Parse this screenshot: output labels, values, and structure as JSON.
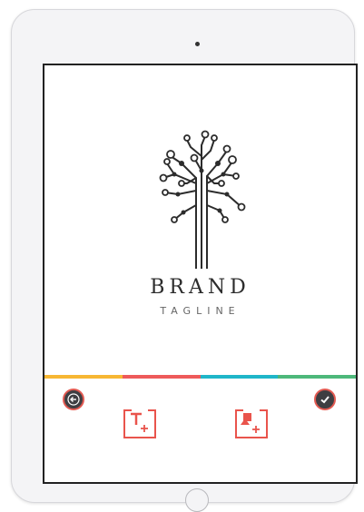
{
  "logo": {
    "brand": "BRAND",
    "tagline": "TAGLINE",
    "icon": "circuit-tree-icon"
  },
  "colors": {
    "accent": "#e9544c",
    "bar_segments": [
      "#f7b733",
      "#ee5a5a",
      "#1fb6c9",
      "#4db87a"
    ]
  },
  "toolbar": {
    "back_icon": "arrow-left-icon",
    "confirm_icon": "check-icon",
    "text_tool_icon": "add-text-icon",
    "image_tool_icon": "add-image-icon"
  }
}
